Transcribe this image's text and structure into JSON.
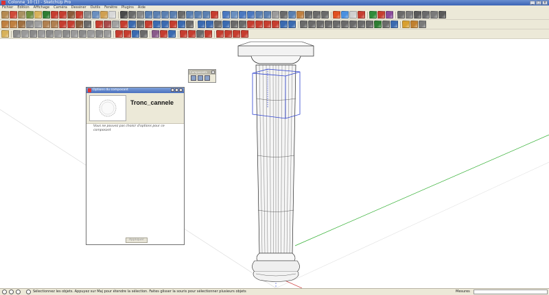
{
  "window": {
    "title": "Colonne_10 (1) - SketchUp Pro",
    "controls": [
      "_",
      "□",
      "x"
    ]
  },
  "menu": {
    "items": [
      "Fichier",
      "Edition",
      "Affichage",
      "Caméra",
      "Dessiner",
      "Outils",
      "Fenêtre",
      "Plugins",
      "Aide"
    ]
  },
  "toolbars": {
    "row1": [
      "#b58a50",
      "#d04a3a",
      "#a89060",
      "#6f8f3f",
      "#d8b25a",
      "#2e7d32",
      "#c63d2f",
      "#c63d2f",
      "#8a5a3a",
      "#c63d2f",
      "#8c8c8c",
      "#6a8fbf",
      "#d0a050",
      "#d8d8d8",
      "|",
      "#4a4a4a",
      "#6a6a6a",
      "#888888",
      "#5a7fb0",
      "#5a7fb0",
      "#5a7fb0",
      "#5a7fb0",
      "#6a6a6a",
      "#5a7fb0",
      "#5a7fb0",
      "#5a7fb0",
      "#c63d2f",
      "|",
      "#4a78c0",
      "#6a8fbf",
      "#4a78c0",
      "#4a78c0",
      "#5a7fb0",
      "#5a7fb0",
      "#9a9a9a",
      "#6a6a6a",
      "#5a7fb0",
      "#c08040",
      "#6a6a6a",
      "#6a6a6a",
      "#6a6a6a",
      "|",
      "#e05020",
      "#4a90e0",
      "#d0d0d0",
      "#c63d2f",
      "|",
      "#2e8b3a",
      "#c63d2f",
      "#8a4a9a",
      "|",
      "#6a6a6a",
      "#7a7a7a",
      "#5a5a5a",
      "#6a6a6a",
      "#7a7a7a",
      "#5a5a5a"
    ],
    "row2": [
      "#c08040",
      "#c08040",
      "#a07040",
      "#8a8a8a",
      "#a0a0a0",
      "#b08050",
      "#b08050",
      "#c63d2f",
      "#c63d2f",
      "#8a5a3a",
      "#6a6a6a",
      "|",
      "#c63d2f",
      "#a84a4a",
      "#a0a0a0",
      "#c63d2f",
      "#3a6ab0",
      "#6a6a6a",
      "#c63d2f",
      "#3a6ab0",
      "#3a6ab0",
      "#c63d2f",
      "#3a6ab0",
      "#6a6a6a",
      "|",
      "#3a6ab0",
      "#3a6ab0",
      "#6a6a6a",
      "#3a6ab0",
      "#6a6a6a",
      "#6a6a6a",
      "#c63d2f",
      "#c63d2f",
      "#c63d2f",
      "#c63d2f",
      "#3a6ab0",
      "#3a6ab0",
      "|",
      "#6a6a6a",
      "#6a6a6a",
      "#6a6a6a",
      "#6a6a6a",
      "#6a6a6a",
      "#6a6a6a",
      "#6a6a6a",
      "#6a6a6a",
      "#6a6a6a",
      "#2e7d32",
      "#6a6a6a",
      "#3a6ab0",
      "|",
      "#d8a030",
      "#c08030",
      "#7a7a7a"
    ],
    "row3": [
      "#d8b25a",
      "|",
      "#8a8a8a",
      "#9a9a9a",
      "#8a8a8a",
      "#9a9a9a",
      "#8a8a8a",
      "#9a9a9a",
      "#8a8a8a",
      "#9a9a9a",
      "#8a8a8a",
      "#9a9a9a",
      "#8a8a8a",
      "#9a9a9a",
      "|",
      "#c63d2f",
      "#c63d2f",
      "#3a6ab0",
      "#6a6a6a",
      "|",
      "#8a5a8a",
      "#c63d2f",
      "#3a6ab0",
      "|",
      "#c63d2f",
      "#c63d2f",
      "#6a6a6a",
      "#c63d2f",
      "|",
      "#c63d2f",
      "#c63d2f",
      "#c63d2f",
      "#c63d2f"
    ]
  },
  "components_tray": {
    "title": "Composants"
  },
  "component_options": {
    "title": "Options du composant",
    "name": "Tronc_cannele",
    "message": "Vous ne pouvez pas choisir d'options pour ce composant",
    "apply_label": "Appliquer"
  },
  "status": {
    "message": "Sélectionnez les objets. Appuyez sur Maj pour étendre la sélection. Faites glisser la souris pour sélectionner plusieurs objets",
    "measure_label": "Mesures",
    "measure_value": ""
  },
  "colors": {
    "selection": "#2b3fd0",
    "axis_green": "#2fae2f",
    "axis_red": "#d04040",
    "guide": "#cfcfcf"
  }
}
